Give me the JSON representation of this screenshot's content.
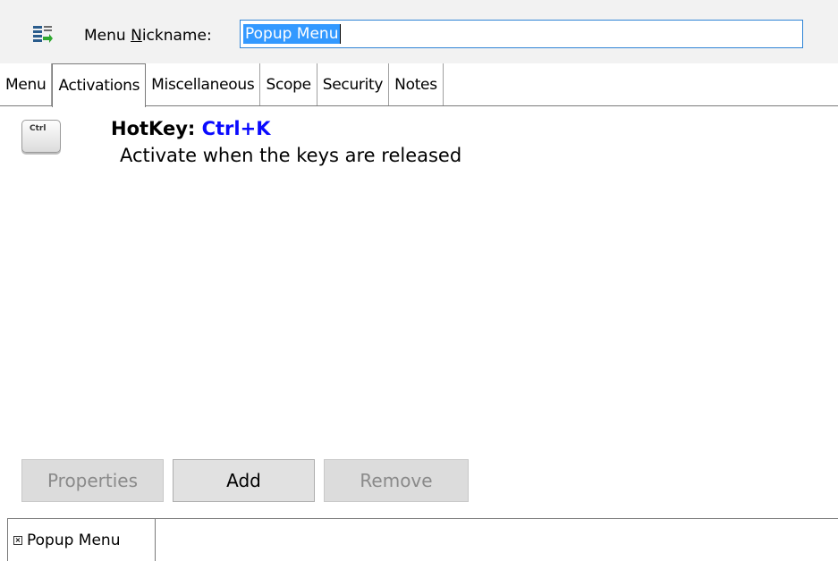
{
  "header": {
    "icon": "menu-list-icon",
    "nickname_label_pre": "Menu ",
    "nickname_label_accel": "N",
    "nickname_label_post": "ickname:",
    "nickname_value": "Popup Menu"
  },
  "tabs": [
    {
      "label": "Menu",
      "active": false
    },
    {
      "label": "Activations",
      "active": true
    },
    {
      "label": "Miscellaneous",
      "active": false
    },
    {
      "label": "Scope",
      "active": false
    },
    {
      "label": "Security",
      "active": false
    },
    {
      "label": "Notes",
      "active": false
    }
  ],
  "activation": {
    "key_icon": "ctrl-key-icon",
    "key_icon_text": "Ctrl",
    "type_label": "HotKey:",
    "value": "Ctrl+K",
    "description": "Activate when the keys are released"
  },
  "buttons": {
    "properties": "Properties",
    "add": "Add",
    "remove": "Remove"
  },
  "bottom_tab": {
    "icon": "close-icon",
    "close_glyph": "×",
    "label": "Popup Menu"
  },
  "colors": {
    "hotkey_value": "#0a0aff",
    "selection": "#3399ff",
    "input_border": "#2f84d6"
  }
}
